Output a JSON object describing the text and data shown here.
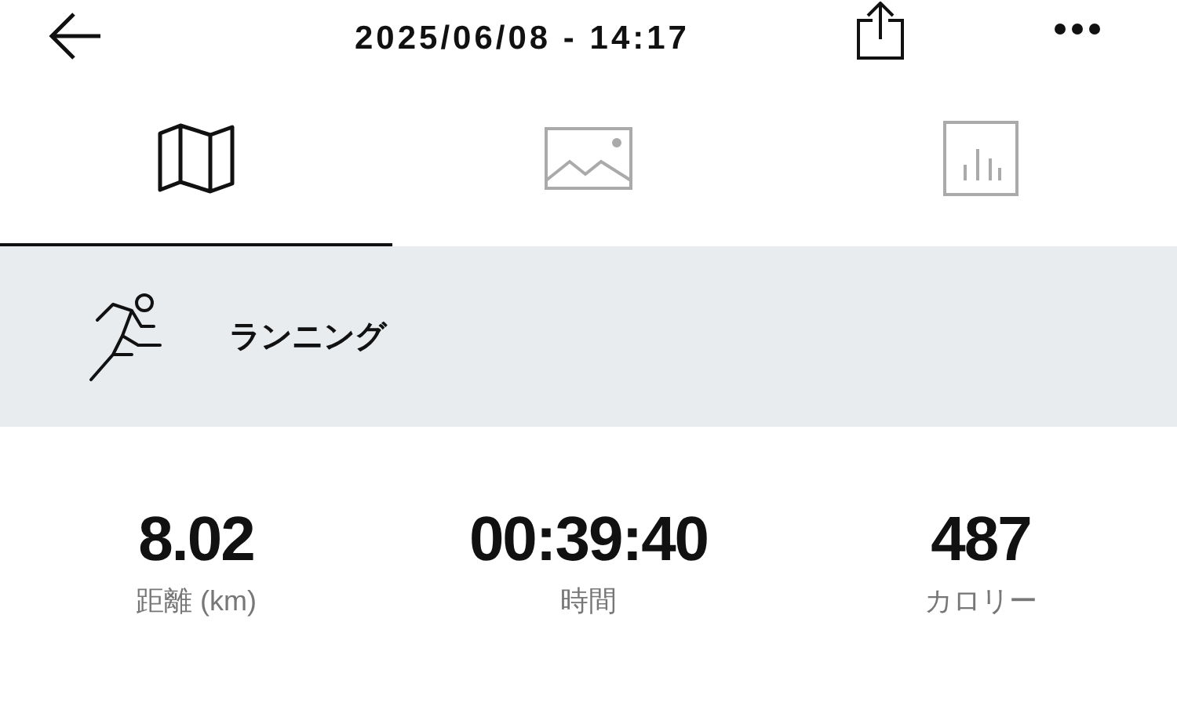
{
  "header": {
    "title": "2025/06/08 - 14:17"
  },
  "tabs": [
    {
      "kind": "map",
      "selected": true
    },
    {
      "kind": "photo",
      "selected": false
    },
    {
      "kind": "chart",
      "selected": false
    }
  ],
  "activity": {
    "label": "ランニング"
  },
  "stats": [
    {
      "value": "8.02",
      "label": "距離 (km)"
    },
    {
      "value": "00:39:40",
      "label": "時間"
    },
    {
      "value": "487",
      "label": "カロリー"
    }
  ]
}
